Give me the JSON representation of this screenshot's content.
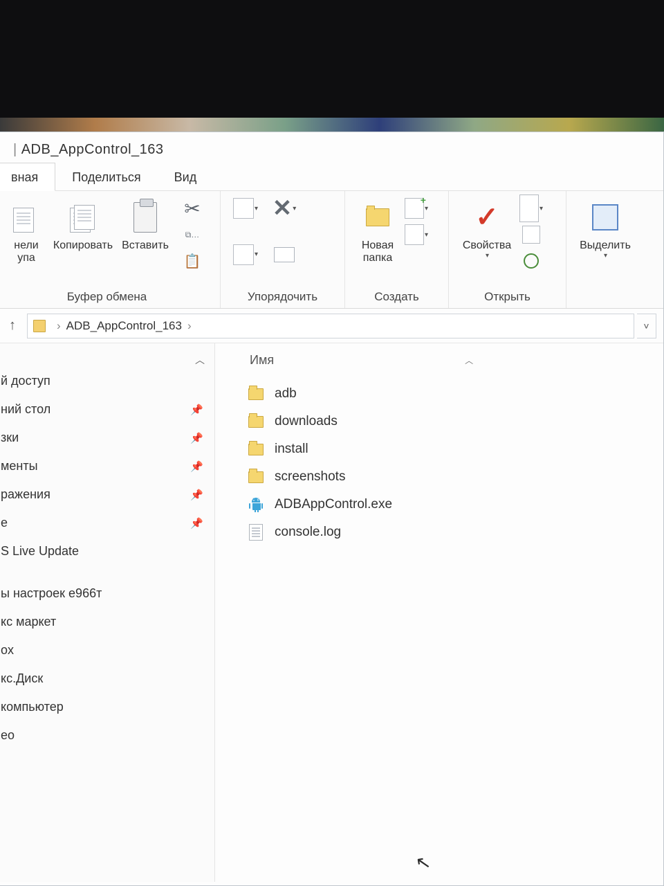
{
  "title": "ADB_AppControl_163",
  "tabs": {
    "main": "вная",
    "share": "Поделиться",
    "view": "Вид"
  },
  "ribbon": {
    "clipboard_group": "Буфер обмена",
    "organize_group": "Упорядочить",
    "create_group": "Создать",
    "open_group": "Открыть",
    "pin_label": "нели\nупа",
    "copy": "Копировать",
    "paste": "Вставить",
    "new_folder": "Новая\nпапка",
    "properties": "Свойства",
    "select": "Выделить"
  },
  "breadcrumb": {
    "folder": "ADB_AppControl_163"
  },
  "sidebar": {
    "quick_access": "й доступ",
    "items": [
      {
        "label": "ний стол",
        "pinned": true
      },
      {
        "label": "зки",
        "pinned": true
      },
      {
        "label": "менты",
        "pinned": true
      },
      {
        "label": "ражения",
        "pinned": true
      },
      {
        "label": "e",
        "pinned": true
      },
      {
        "label": "S Live Update",
        "pinned": false
      },
      {
        "label": "",
        "pinned": false
      },
      {
        "label": "ы настроек e966т",
        "pinned": false
      },
      {
        "label": "кс маркет",
        "pinned": false
      },
      {
        "label": "ox",
        "pinned": false
      },
      {
        "label": "кс.Диск",
        "pinned": false
      },
      {
        "label": "компьютер",
        "pinned": false
      },
      {
        "label": "ео",
        "pinned": false
      }
    ]
  },
  "filelist": {
    "col_name": "Имя",
    "items": [
      {
        "name": "adb",
        "type": "folder"
      },
      {
        "name": "downloads",
        "type": "folder"
      },
      {
        "name": "install",
        "type": "folder"
      },
      {
        "name": "screenshots",
        "type": "folder"
      },
      {
        "name": "ADBAppControl.exe",
        "type": "exe-android"
      },
      {
        "name": "console.log",
        "type": "txt"
      }
    ]
  }
}
